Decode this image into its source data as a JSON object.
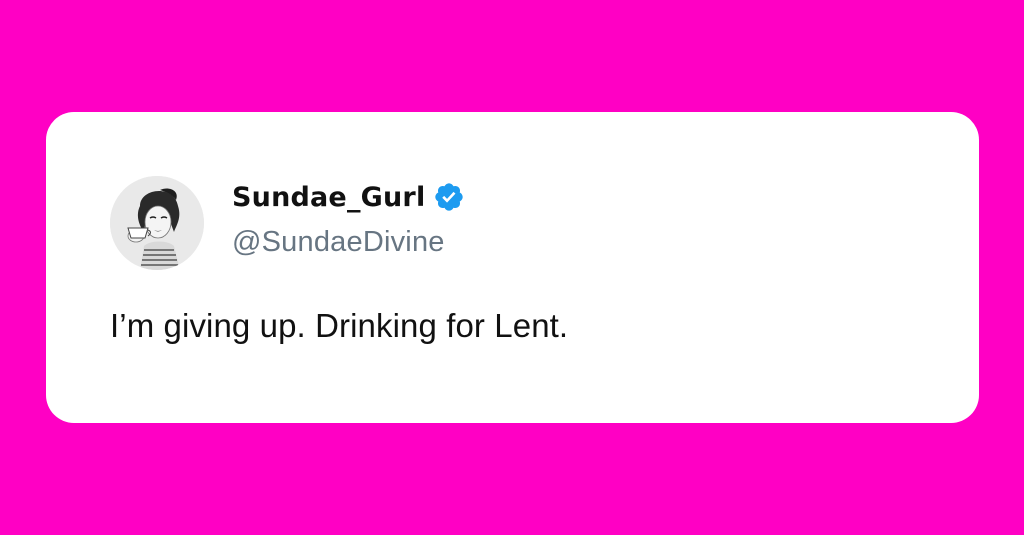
{
  "tweet": {
    "display_name": "Sundae_Gurl",
    "handle": "@SundaeDivine",
    "text": "I’m giving up. Drinking for Lent.",
    "verified_icon": "verified-badge-icon",
    "avatar_icon": "retro-woman-drinking-avatar"
  },
  "colors": {
    "background": "#ff00c4",
    "card": "#ffffff",
    "verified": "#1d9bf0",
    "handle": "#677582",
    "text": "#111111"
  }
}
